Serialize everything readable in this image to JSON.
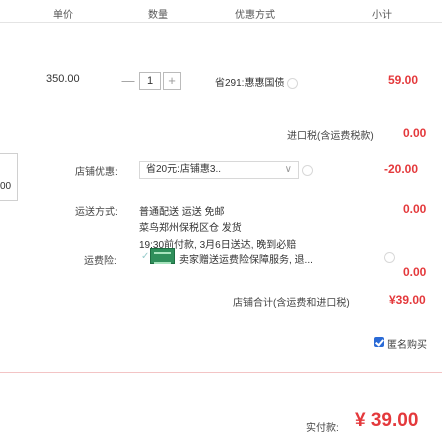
{
  "header": {
    "unit_price": "单价",
    "quantity": "数量",
    "promo": "优惠方式",
    "subtotal": "小计"
  },
  "item": {
    "unit_price": "350.00",
    "quantity": "1",
    "minus": "—",
    "plus": "+",
    "promo_text": "省291:惠惠国债",
    "subtotal": "59.00"
  },
  "import_tax": {
    "label": "进口税(含运费税款)",
    "value": "0.00"
  },
  "store_discount": {
    "label": "店铺优惠:",
    "selected": "省20元:店铺惠3..",
    "value": "-20.00",
    "left_fragment": "00"
  },
  "shipping": {
    "label": "运送方式:",
    "line1": "普通配送 运送 免邮",
    "line2": "菜鸟郑州保税区仓 发货",
    "line3": "19:30前付款, 3月6日送达, 晚到必赔",
    "value": "0.00"
  },
  "insurance": {
    "label": "运费险:",
    "text": "卖家赠送运费险保障服务, 退...",
    "value": "0.00"
  },
  "store_total": {
    "label": "店铺合计(含运费和进口税)",
    "value": "¥39.00"
  },
  "anonymous": {
    "label": "匿名购买"
  },
  "payment": {
    "label": "实付款:",
    "value": "¥ 39.00"
  },
  "colors": {
    "accent": "#e4393c",
    "border": "#e4e4e4"
  }
}
